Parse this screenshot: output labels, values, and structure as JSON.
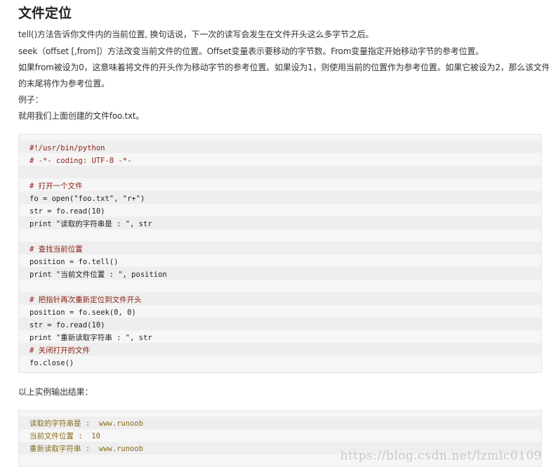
{
  "title": "文件定位",
  "paragraphs": [
    "tell()方法告诉你文件内的当前位置, 换句话说，下一次的读写会发生在文件开头这么多字节之后。",
    "seek（offset [,from]）方法改变当前文件的位置。Offset变量表示要移动的字节数。From变量指定开始移动字节的参考位置。",
    "如果from被设为0，这意味着将文件的开头作为移动字节的参考位置。如果设为1，则使用当前的位置作为参考位置。如果它被设为2，那么该文件",
    "的末尾将作为参考位置。",
    "例子：",
    "就用我们上面创建的文件foo.txt。"
  ],
  "code": {
    "lines": [
      "#!/usr/bin/python",
      "# -*- coding: UTF-8 -*-",
      "",
      "# 打开一个文件",
      "fo = open(\"foo.txt\", \"r+\")",
      "str = fo.read(10)",
      "print \"读取的字符串是 : \", str",
      "",
      "# 查找当前位置",
      "position = fo.tell()",
      "print \"当前文件位置 : \", position",
      "",
      "# 把指针再次重新定位到文件开头",
      "position = fo.seek(0, 0)",
      "str = fo.read(10)",
      "print \"重新读取字符串 : \", str",
      "# 关闭打开的文件",
      "fo.close()"
    ]
  },
  "output_intro": "以上实例输出结果：",
  "output": {
    "lines": [
      "读取的字符串是 :  www.runoob",
      "当前文件位置 :  10",
      "重新读取字符串 :  www.runoob"
    ]
  },
  "watermark": "https://blog.csdn.net/lzmlc0109"
}
